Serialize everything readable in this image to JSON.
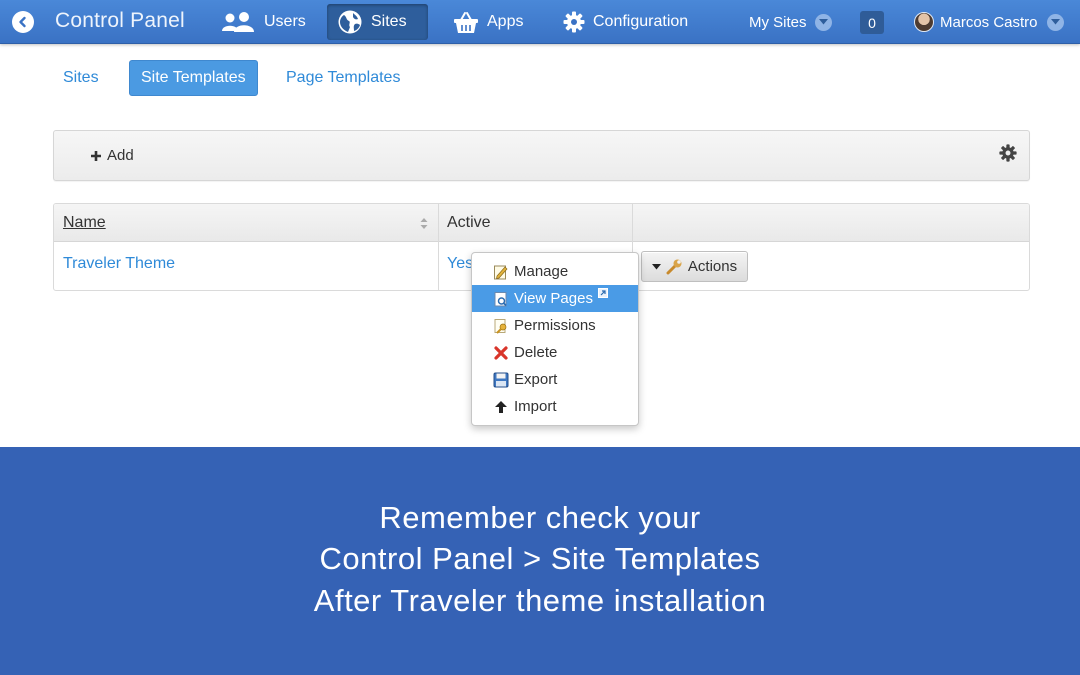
{
  "topbar": {
    "title": "Control Panel",
    "nav": [
      {
        "label": "Users",
        "icon": "users-icon"
      },
      {
        "label": "Sites",
        "icon": "globe-icon",
        "active": true
      },
      {
        "label": "Apps",
        "icon": "basket-icon"
      },
      {
        "label": "Configuration",
        "icon": "gear-icon"
      }
    ],
    "my_sites_label": "My Sites",
    "notification_count": "0",
    "user_name": "Marcos Castro"
  },
  "tabs": [
    {
      "label": "Sites"
    },
    {
      "label": "Site Templates",
      "active": true
    },
    {
      "label": "Page Templates"
    }
  ],
  "toolbar": {
    "add_label": "Add"
  },
  "table": {
    "columns": [
      "Name",
      "Active",
      ""
    ],
    "rows": [
      {
        "name": "Traveler Theme",
        "active": "Yes"
      }
    ],
    "actions_label": "Actions"
  },
  "actions_menu": {
    "items": [
      {
        "label": "Manage",
        "icon": "manage-icon"
      },
      {
        "label": "View Pages",
        "icon": "view-pages-icon",
        "highlighted": true
      },
      {
        "label": "Permissions",
        "icon": "key-icon"
      },
      {
        "label": "Delete",
        "icon": "delete-x-icon"
      },
      {
        "label": "Export",
        "icon": "save-disk-icon"
      },
      {
        "label": "Import",
        "icon": "arrow-up-icon"
      }
    ]
  },
  "banner": {
    "lines": [
      "Remember check your",
      "Control Panel > Site Templates",
      "After Traveler theme installation"
    ]
  },
  "colors": {
    "topbar": "#3a72c4",
    "link": "#2f8ad8",
    "active_tab": "#4b9ae2",
    "banner": "#3562b5",
    "menu_highlight": "#4a9be6"
  }
}
